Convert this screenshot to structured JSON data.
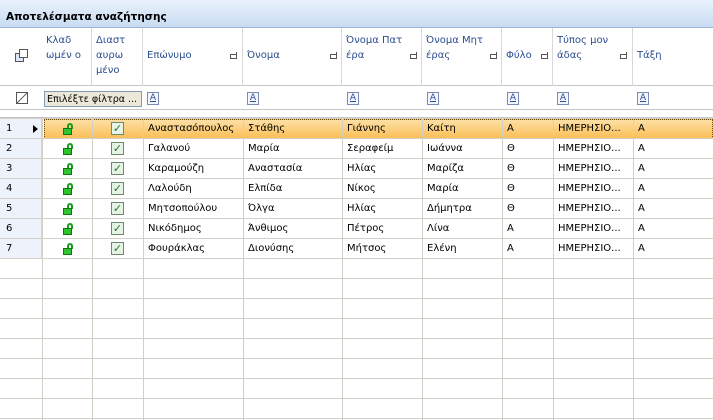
{
  "title": "Αποτελέσματα αναζήτησης",
  "columns": [
    {
      "label": "Κλαδ ωμέν ο"
    },
    {
      "label": "Διαστ αυρω μένο"
    },
    {
      "label": "Επώνυμο"
    },
    {
      "label": "Όνομα"
    },
    {
      "label": "Όνομα Πατ έρα"
    },
    {
      "label": "Όνομα Μητ έρας"
    },
    {
      "label": "Φύλο"
    },
    {
      "label": "Τύπος μον άδας"
    },
    {
      "label": "Τάξη"
    }
  ],
  "filter": {
    "select_text": "Επιλέξτε φίλτρα ...",
    "filter_icon_letter": "A"
  },
  "rows": [
    {
      "num": "1",
      "surname": "Αναστασόπουλος",
      "name": "Στάθης",
      "father": "Γιάννης",
      "mother": "Καίτη",
      "sex": "Α",
      "unit": "ΗΜΕΡΗΣΙΟ...",
      "class": "Α"
    },
    {
      "num": "2",
      "surname": "Γαλανού",
      "name": "Μαρία",
      "father": "Σεραφείμ",
      "mother": "Ιωάννα",
      "sex": "Θ",
      "unit": "ΗΜΕΡΗΣΙΟ...",
      "class": "Α"
    },
    {
      "num": "3",
      "surname": "Καραμούζη",
      "name": "Αναστασία",
      "father": "Ηλίας",
      "mother": "Μαρίζα",
      "sex": "Θ",
      "unit": "ΗΜΕΡΗΣΙΟ...",
      "class": "Α"
    },
    {
      "num": "4",
      "surname": "Λαλούδη",
      "name": "Ελπίδα",
      "father": "Νίκος",
      "mother": "Μαρία",
      "sex": "Θ",
      "unit": "ΗΜΕΡΗΣΙΟ...",
      "class": "Α"
    },
    {
      "num": "5",
      "surname": "Μητσοπούλου",
      "name": "Όλγα",
      "father": "Ηλίας",
      "mother": "Δήμητρα",
      "sex": "Θ",
      "unit": "ΗΜΕΡΗΣΙΟ...",
      "class": "Α"
    },
    {
      "num": "6",
      "surname": "Νικόδημος",
      "name": "Άνθιμος",
      "father": "Πέτρος",
      "mother": "Λίνα",
      "sex": "Α",
      "unit": "ΗΜΕΡΗΣΙΟ...",
      "class": "Α"
    },
    {
      "num": "7",
      "surname": "Φουράκλας",
      "name": "Διονύσης",
      "father": "Μήτσος",
      "mother": "Ελένη",
      "sex": "Α",
      "unit": "ΗΜΕΡΗΣΙΟ...",
      "class": "Α"
    }
  ],
  "selected_row": "1",
  "colors": {
    "selection": "#fbbf57",
    "header_text": "#2a4d8f",
    "lock": "#2fc42f"
  }
}
